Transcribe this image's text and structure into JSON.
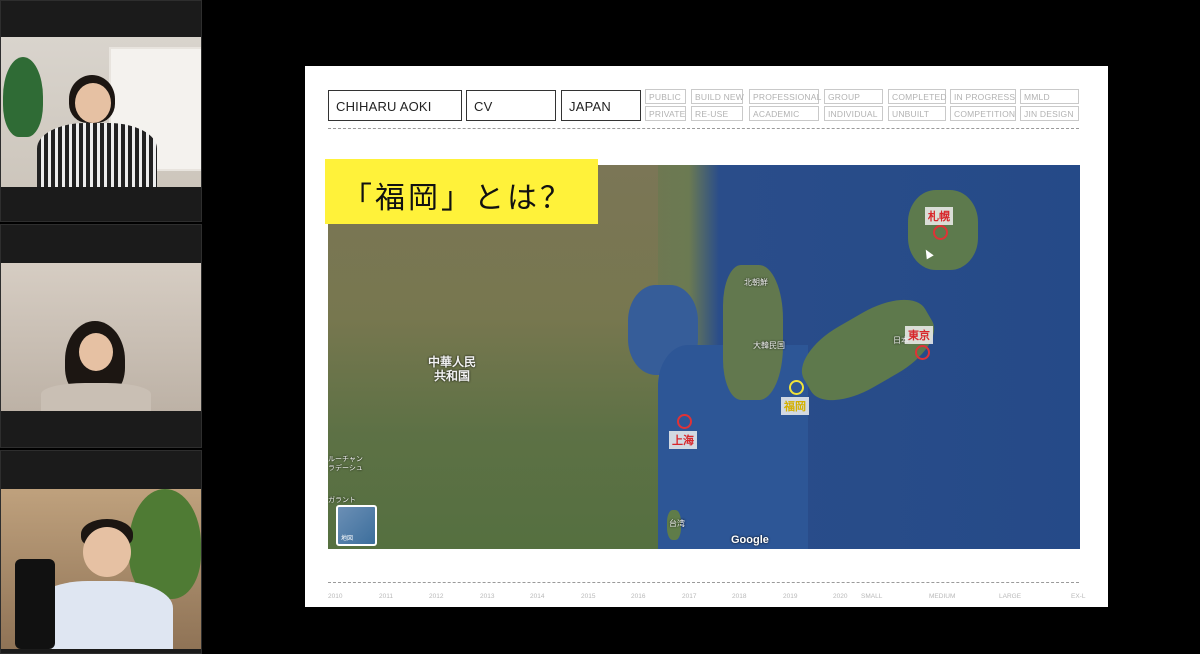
{
  "participants": [
    {
      "id": "p1"
    },
    {
      "id": "p2"
    },
    {
      "id": "p3"
    }
  ],
  "slide": {
    "header_boxes": [
      "CHIHARU AOKI",
      "CV",
      "JAPAN"
    ],
    "tags": [
      [
        "PUBLIC",
        "PRIVATE"
      ],
      [
        "BUILD NEW",
        "RE-USE"
      ],
      [
        "PROFESSIONAL",
        "ACADEMIC"
      ],
      [
        "GROUP",
        "INDIVIDUAL"
      ],
      [
        "COMPLETED",
        "UNBUILT"
      ],
      [
        "IN PROGRESS",
        "COMPETITION"
      ],
      [
        "MMLD",
        "JIN DESIGN"
      ]
    ],
    "title": "「福岡」とは？",
    "map": {
      "cities": {
        "sapporo": "札幌",
        "tokyo": "東京",
        "fukuoka": "福岡",
        "shanghai": "上海"
      },
      "labels": {
        "china": "中華人民\n共和国",
        "north_korea": "北朝鮮",
        "south_korea": "大韓民国",
        "taiwan": "台湾",
        "japan": "日本",
        "left_edge": "ルーチャン\nラデーシュ",
        "left_edge2": "ガラント"
      },
      "attribution": "Google",
      "thumb_label": "地図"
    },
    "timeline": [
      "2010",
      "2011",
      "2012",
      "2013",
      "2014",
      "2015",
      "2016",
      "2017",
      "2018",
      "2019",
      "2020",
      "SMALL",
      "MEDIUM",
      "LARGE",
      "EX-L"
    ]
  }
}
